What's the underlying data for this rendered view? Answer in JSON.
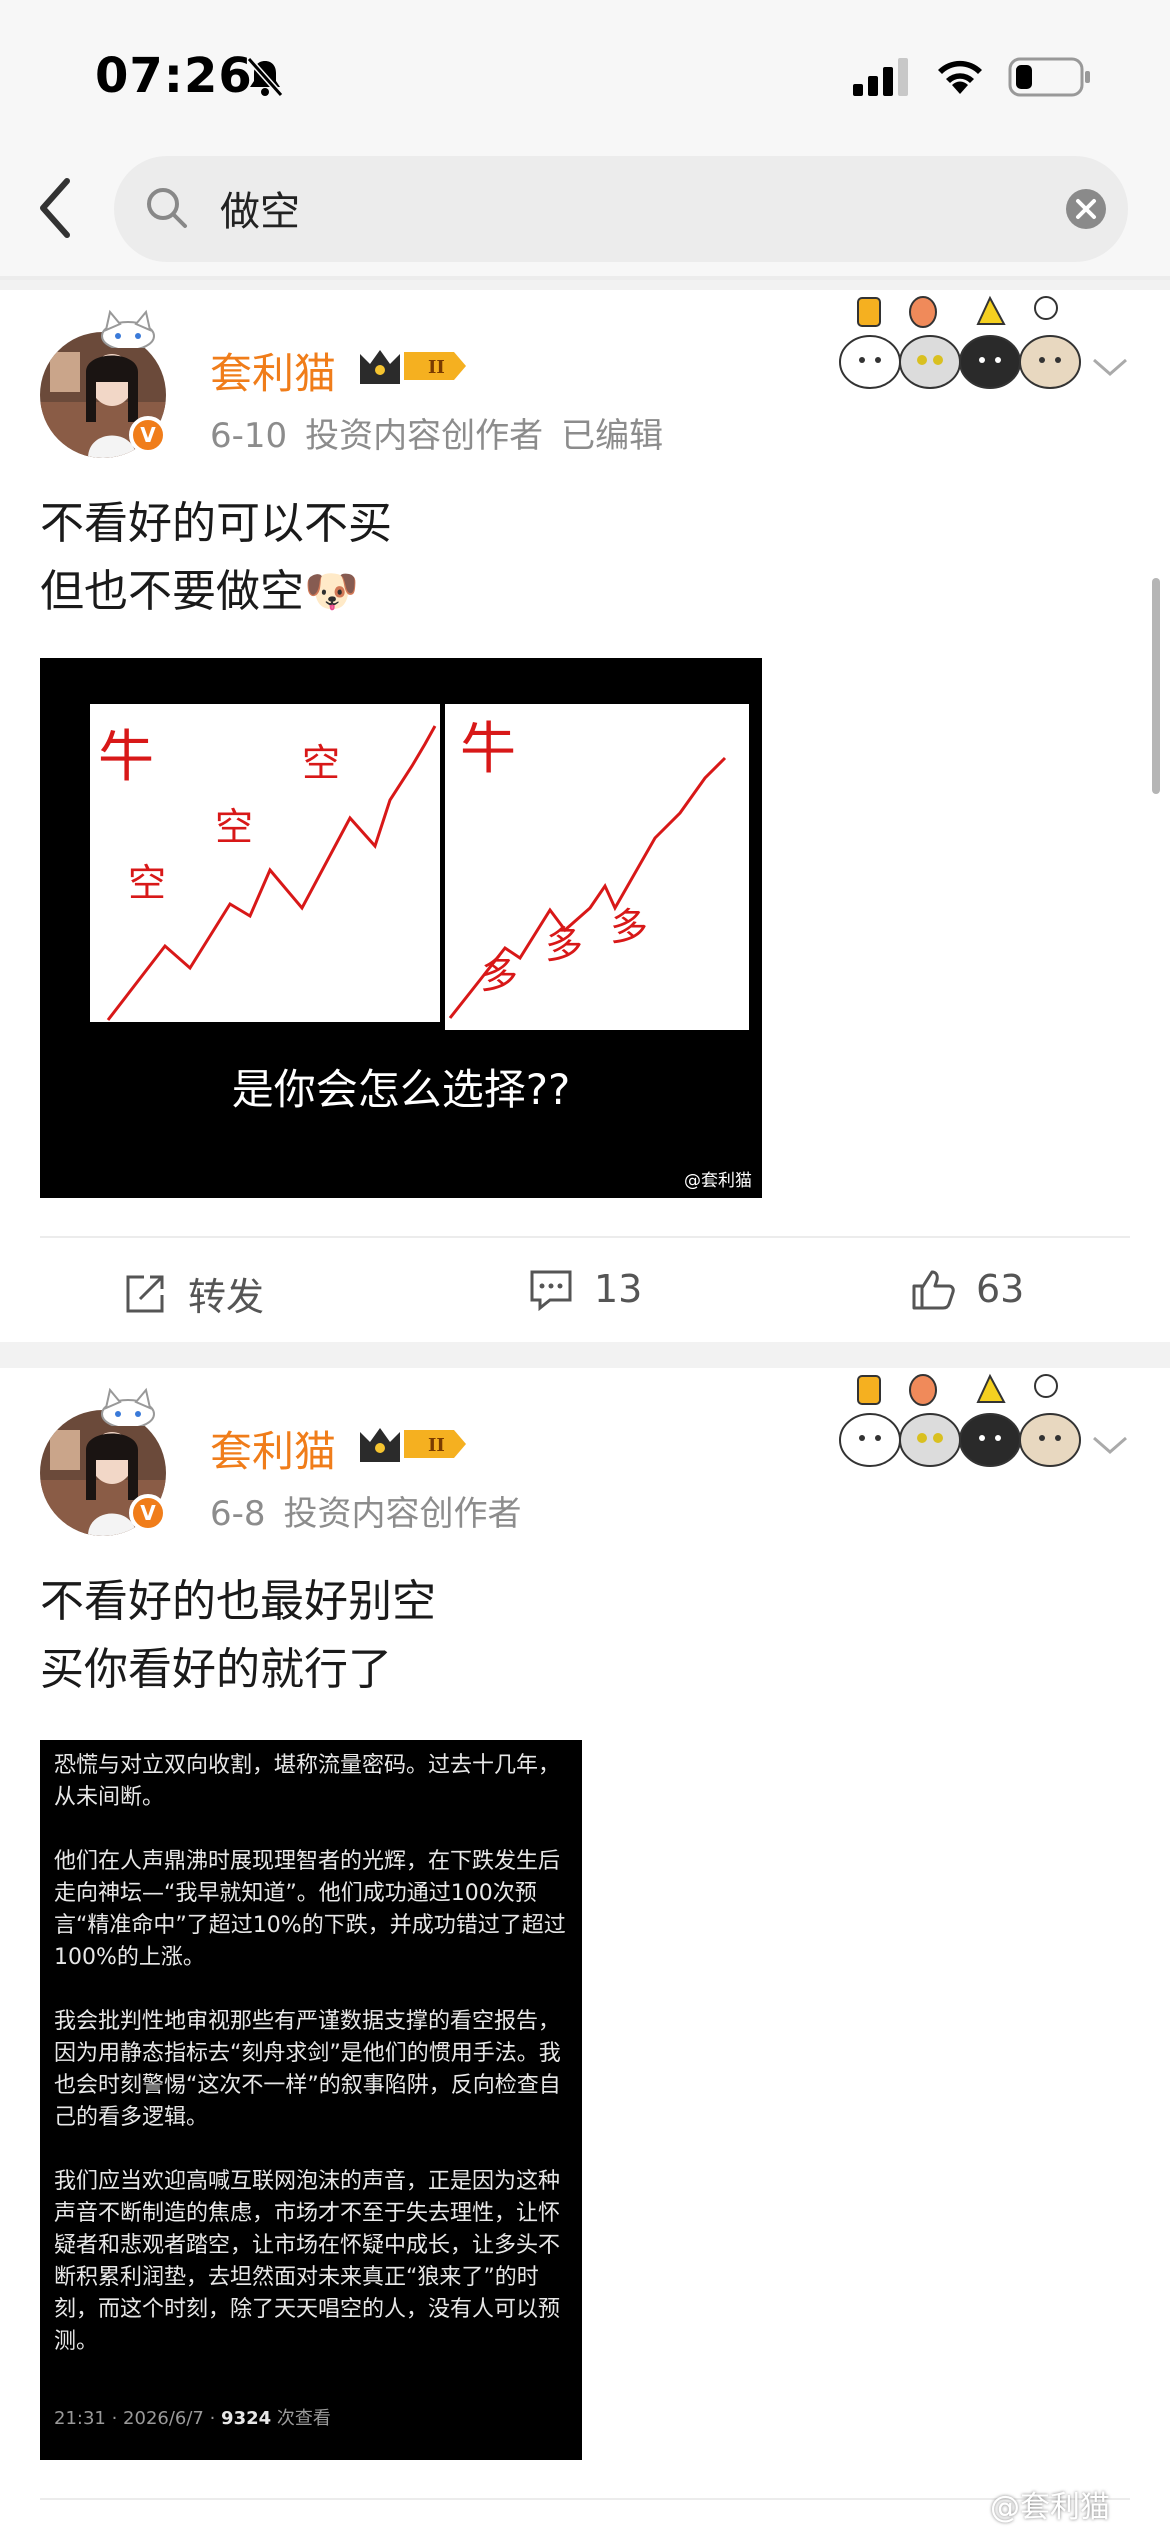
{
  "status": {
    "time": "07:26"
  },
  "search": {
    "query": "做空"
  },
  "posts": [
    {
      "user": "套利猫",
      "date": "6-10",
      "role": "投资内容创作者",
      "edited": "已编辑",
      "text_lines": [
        "不看好的可以不买",
        "但也不要做空🐶"
      ],
      "image": {
        "left_label": "牛",
        "left_marks": [
          "空",
          "空",
          "空"
        ],
        "right_label": "牛",
        "right_marks": [
          "多",
          "多",
          "多"
        ],
        "caption": "是你会怎么选择??",
        "watermark": "@套利猫"
      },
      "actions": {
        "repost": "转发",
        "comments": "13",
        "likes": "63"
      }
    },
    {
      "user": "套利猫",
      "date": "6-8",
      "role": "投资内容创作者",
      "text_lines": [
        "不看好的也最好别空",
        "买你看好的就行了"
      ],
      "image_text": {
        "paragraphs": [
          "恐慌与对立双向收割，堪称流量密码。过去十几年，从未间断。",
          "他们在人声鼎沸时展现理智者的光辉，在下跌发生后走向神坛—“我早就知道”。他们成功通过100次预言“精准命中”了超过10%的下跌，并成功错过了超过100%的上涨。",
          "我会批判性地审视那些有严谨数据支撑的看空报告，因为用静态指标去“刻舟求剑”是他们的惯用手法。我也会时刻警惕“这次不一样”的叙事陷阱，反向检查自己的看多逻辑。",
          "我们应当欢迎高喊互联网泡沫的声音，正是因为这种声音不断制造的焦虑，市场才不至于失去理性，让怀疑者和悲观者踏空，让市场在怀疑中成长，让多头不断积累利润垫，去坦然面对未来真正“狼来了”的时刻，而这个时刻，除了天天唱空的人，没有人可以预测。"
        ],
        "footer_time": "21:31 · 2026/6/7 · ",
        "footer_views": "9324",
        "footer_suffix": " 次查看"
      }
    }
  ],
  "watermark": "@套利猫"
}
